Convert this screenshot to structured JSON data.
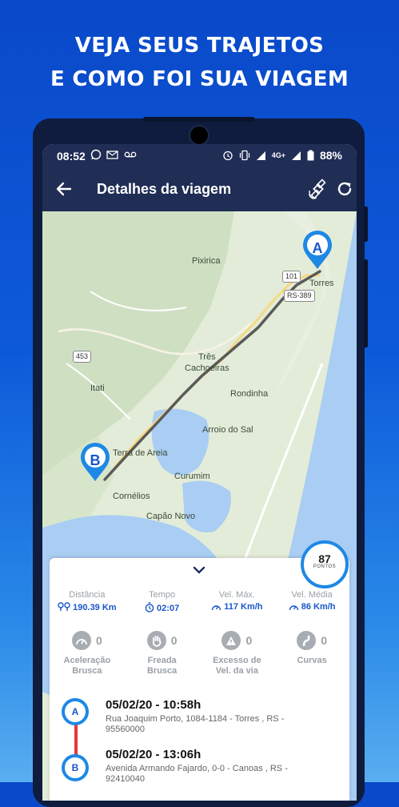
{
  "headline": {
    "line1": "VEJA SEUS TRAJETOS",
    "line2": "E COMO FOI SUA VIAGEM"
  },
  "statusbar": {
    "time": "08:52",
    "network": "4G+",
    "battery": "88%"
  },
  "appbar": {
    "title": "Detalhes da viagem"
  },
  "map": {
    "labels": {
      "pixirica": "Pixirica",
      "torres": "Torres",
      "tres1": "Três",
      "tres2": "Cachoeiras",
      "itati": "Itati",
      "rondinha": "Rondinha",
      "arroio": "Arroio do Sal",
      "terra": "Terra de Areia",
      "curumim": "Curumim",
      "cornelios": "Cornélios",
      "capao": "Capão Novo"
    },
    "roads": {
      "r101": "101",
      "rs389": "RS-389",
      "r453": "453"
    },
    "markers": {
      "start": "A",
      "end": "B"
    }
  },
  "score": {
    "value": "87",
    "label": "PONTOS"
  },
  "stats": [
    {
      "label": "Distância",
      "value": "190.39 Km"
    },
    {
      "label": "Tempo",
      "value": "02:07"
    },
    {
      "label": "Vel. Máx.",
      "value": "117 Km/h"
    },
    {
      "label": "Vel. Média",
      "value": "86 Km/h"
    }
  ],
  "events": [
    {
      "count": "0",
      "line1": "Aceleração",
      "line2": "Brusca"
    },
    {
      "count": "0",
      "line1": "Freada",
      "line2": "Brusca"
    },
    {
      "count": "0",
      "line1": "Excesso de",
      "line2": "Vel. da via"
    },
    {
      "count": "0",
      "line1": "Curvas",
      "line2": ""
    }
  ],
  "trip": {
    "start": {
      "marker": "A",
      "datetime": "05/02/20 - 10:58h",
      "address": "Rua Joaquim Porto, 1084-1184 - Torres , RS - 95560000"
    },
    "end": {
      "marker": "B",
      "datetime": "05/02/20 - 13:06h",
      "address": "Avenida Armando Fajardo, 0-0 - Canoas , RS - 92410040"
    }
  },
  "colors": {
    "primary": "#202d55",
    "accent": "#1e88e5",
    "route": "#5a5a5a",
    "water": "#a9cdf3"
  }
}
